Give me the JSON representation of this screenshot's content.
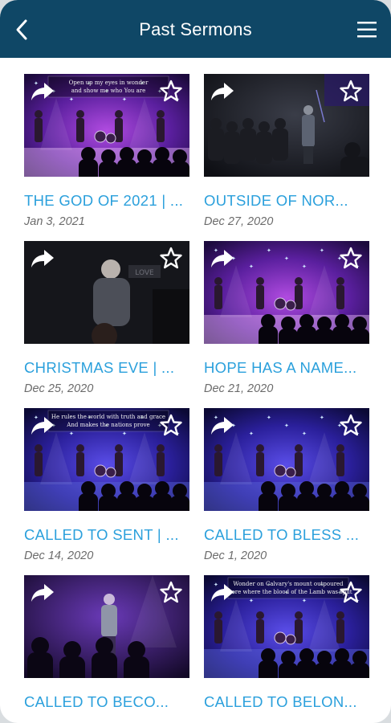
{
  "header": {
    "title": "Past Sermons",
    "back_icon": "chevron-left-icon",
    "menu_icon": "hamburger-menu-icon"
  },
  "colors": {
    "header_bg": "#0f4766",
    "title_blue": "#2ba0dc",
    "date_gray": "#6b6b6b"
  },
  "sermons": [
    {
      "title": "THE GOD OF 2021 | ...",
      "date": "Jan 3, 2021",
      "overlay_text": "Open up my eyes in wonder / and show me who You are",
      "scene": "band-purple"
    },
    {
      "title": "OUTSIDE OF NOR...",
      "date": "Dec 27, 2020",
      "overlay_text": "",
      "scene": "speaker-dark"
    },
    {
      "title": "CHRISTMAS EVE | ...",
      "date": "Dec 25, 2020",
      "overlay_text": "",
      "scene": "speaker-closeup"
    },
    {
      "title": "HOPE HAS A NAME...",
      "date": "Dec 21, 2020",
      "overlay_text": "",
      "scene": "band-purple"
    },
    {
      "title": "CALLED TO SENT | ...",
      "date": "Dec 14, 2020",
      "overlay_text": "He rules the world with truth and grace / And makes the nations prove",
      "scene": "band-blue"
    },
    {
      "title": "CALLED TO BLESS ...",
      "date": "Dec 1, 2020",
      "overlay_text": "",
      "scene": "band-blue"
    },
    {
      "title": "CALLED TO BECO...",
      "date": "",
      "overlay_text": "",
      "scene": "speaker-purple"
    },
    {
      "title": "CALLED TO BELON...",
      "date": "",
      "overlay_text": "Wonder on Calvary's mount outpoured / There where the blood of the Lamb was spilt",
      "scene": "band-blue"
    }
  ]
}
